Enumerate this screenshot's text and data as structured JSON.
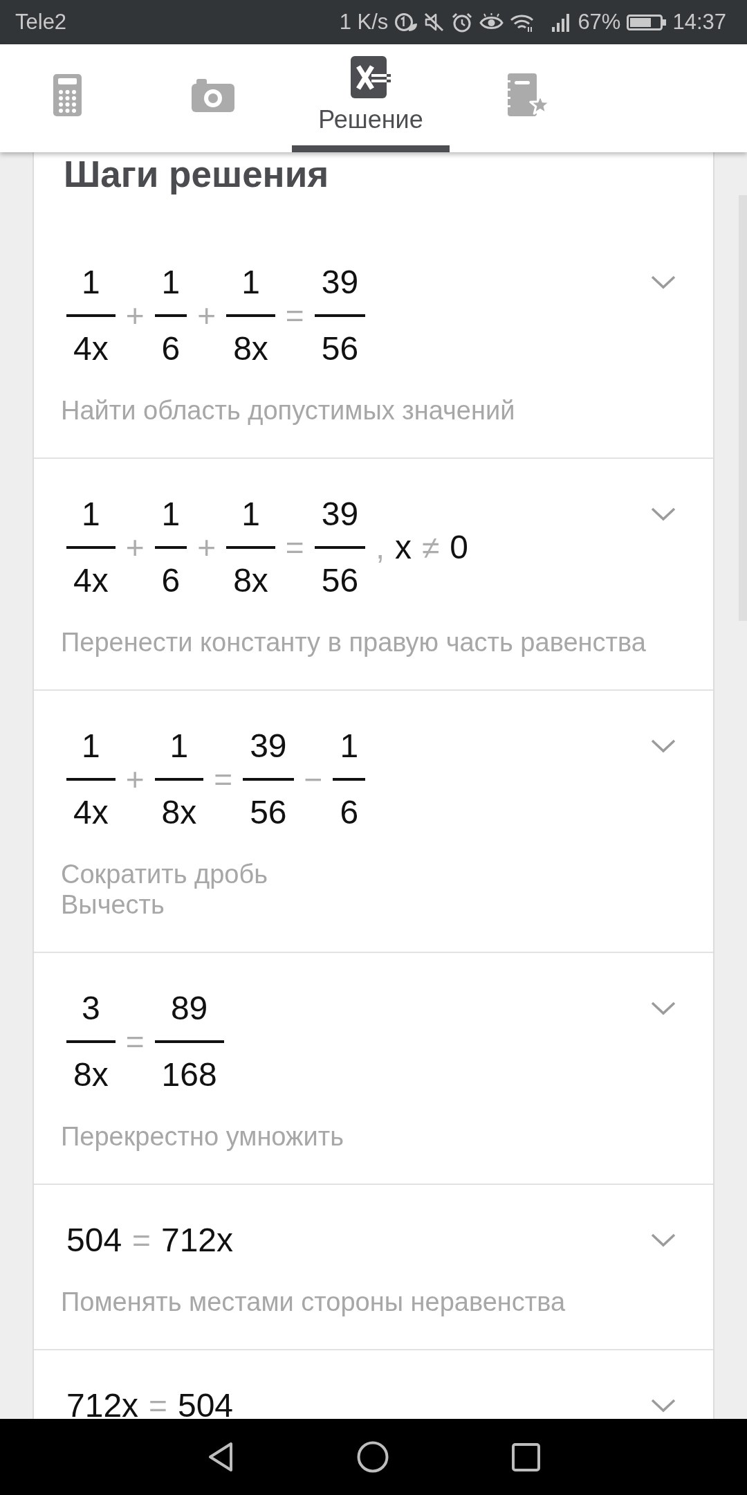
{
  "status_bar": {
    "carrier": "Tele2",
    "network_speed": "1 K/s",
    "battery": "67%",
    "time": "14:37"
  },
  "tabs": [
    {
      "kind": "calculator",
      "selected": false
    },
    {
      "kind": "camera",
      "selected": false
    },
    {
      "kind": "solution",
      "label": "Решение",
      "selected": true
    },
    {
      "kind": "notebook",
      "selected": false
    }
  ],
  "section_title": "Шаги решения",
  "steps": [
    {
      "expression": [
        {
          "kind": "fraction",
          "numerator": "1",
          "denominator": "4x"
        },
        {
          "kind": "operator",
          "text": "+"
        },
        {
          "kind": "fraction",
          "numerator": "1",
          "denominator": "6"
        },
        {
          "kind": "operator",
          "text": "+"
        },
        {
          "kind": "fraction",
          "numerator": "1",
          "denominator": "8x"
        },
        {
          "kind": "operator",
          "text": "="
        },
        {
          "kind": "fraction",
          "numerator": "39",
          "denominator": "56"
        }
      ],
      "description": [
        "Найти область допустимых значений"
      ],
      "expanded": false
    },
    {
      "expression": [
        {
          "kind": "fraction",
          "numerator": "1",
          "denominator": "4x"
        },
        {
          "kind": "operator",
          "text": "+"
        },
        {
          "kind": "fraction",
          "numerator": "1",
          "denominator": "6"
        },
        {
          "kind": "operator",
          "text": "+"
        },
        {
          "kind": "fraction",
          "numerator": "1",
          "denominator": "8x"
        },
        {
          "kind": "operator",
          "text": "="
        },
        {
          "kind": "fraction",
          "numerator": "39",
          "denominator": "56"
        },
        {
          "kind": "operator",
          "text": ","
        },
        {
          "kind": "term",
          "text": "x"
        },
        {
          "kind": "operator",
          "text": "≠"
        },
        {
          "kind": "term",
          "text": "0"
        }
      ],
      "description": [
        "Перенести константу в правую часть равенства"
      ],
      "expanded": false
    },
    {
      "expression": [
        {
          "kind": "fraction",
          "numerator": "1",
          "denominator": "4x"
        },
        {
          "kind": "operator",
          "text": "+"
        },
        {
          "kind": "fraction",
          "numerator": "1",
          "denominator": "8x"
        },
        {
          "kind": "operator",
          "text": "="
        },
        {
          "kind": "fraction",
          "numerator": "39",
          "denominator": "56"
        },
        {
          "kind": "operator",
          "text": "−"
        },
        {
          "kind": "fraction",
          "numerator": "1",
          "denominator": "6"
        }
      ],
      "description": [
        "Сократить дробь",
        "Вычесть"
      ],
      "expanded": false
    },
    {
      "expression": [
        {
          "kind": "fraction",
          "numerator": "3",
          "denominator": "8x"
        },
        {
          "kind": "operator",
          "text": "="
        },
        {
          "kind": "fraction",
          "numerator": "89",
          "denominator": "168"
        }
      ],
      "description": [
        "Перекрестно умножить"
      ],
      "expanded": false
    },
    {
      "expression": [
        {
          "kind": "term",
          "text": "504"
        },
        {
          "kind": "operator",
          "text": "="
        },
        {
          "kind": "term",
          "text": "712x"
        }
      ],
      "description": [
        "Поменять местами стороны неравенства"
      ],
      "expanded": false
    },
    {
      "expression": [
        {
          "kind": "term",
          "text": "712x"
        },
        {
          "kind": "operator",
          "text": "="
        },
        {
          "kind": "term",
          "text": "504"
        }
      ],
      "expanded": false
    }
  ]
}
